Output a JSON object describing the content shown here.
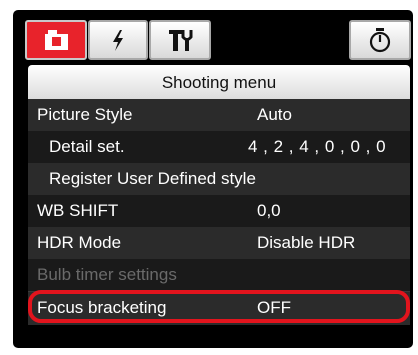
{
  "tabs": [
    {
      "icon": "camera-icon",
      "color": "#e8232b",
      "active": true
    },
    {
      "icon": "flash-icon"
    },
    {
      "icon": "tools-icon"
    },
    {
      "icon": "timer-icon"
    }
  ],
  "header": {
    "title": "Shooting menu"
  },
  "rows": [
    {
      "label": "Picture Style",
      "value": "Auto"
    },
    {
      "label": "Detail set.",
      "value": "4 , 2 , 4 , 0 , 0 , 0"
    },
    {
      "label": "Register User Defined style"
    },
    {
      "label": "WB SHIFT",
      "value": "0,0"
    },
    {
      "label": "HDR Mode",
      "value": "Disable HDR"
    },
    {
      "label": "Bulb timer settings",
      "disabled": true
    },
    {
      "label": "Focus bracketing",
      "value": "OFF",
      "highlighted": true
    }
  ],
  "colors": {
    "highlight": "#e2141d",
    "panel": "#000000"
  }
}
